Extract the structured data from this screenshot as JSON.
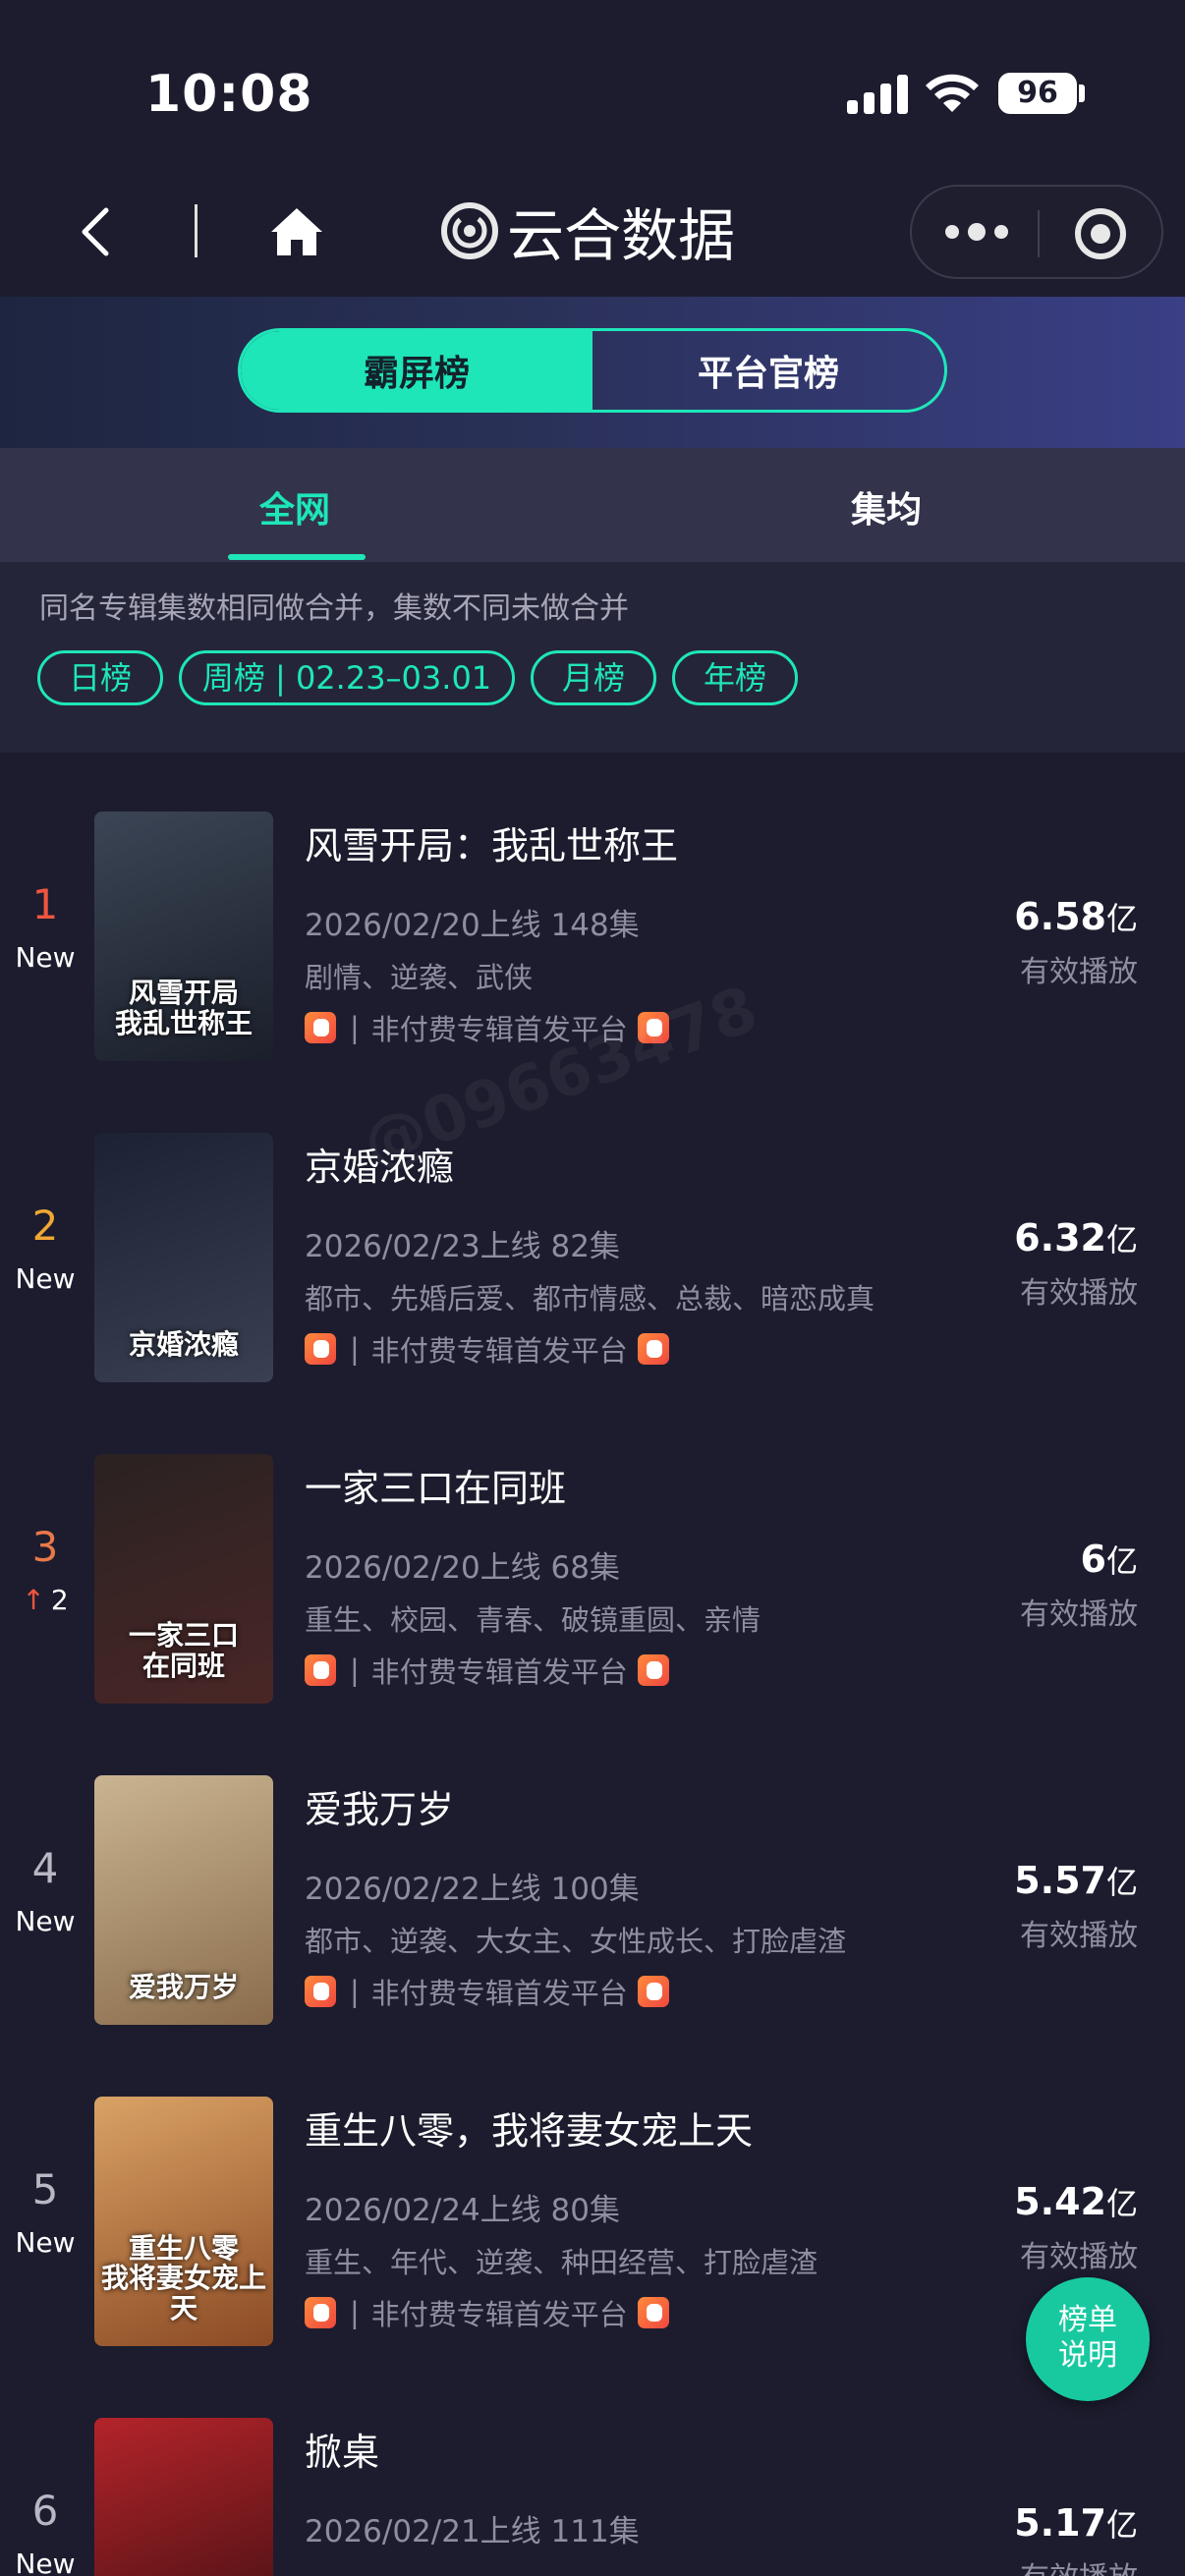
{
  "status_bar": {
    "time": "10:08",
    "battery": "96"
  },
  "nav": {
    "brand_name": "云合数据"
  },
  "segments": [
    {
      "label": "霸屏榜",
      "active": true
    },
    {
      "label": "平台官榜",
      "active": false
    }
  ],
  "tabs": [
    {
      "label": "全网",
      "active": true
    },
    {
      "label": "集均",
      "active": false
    }
  ],
  "filters": {
    "note": "同名专辑集数相同做合并，集数不同未做合并",
    "chips": [
      "日榜",
      "周榜 | 02.23–03.01",
      "月榜",
      "年榜"
    ]
  },
  "list": [
    {
      "rank": "1",
      "badge": "New",
      "title": "风雪开局：我乱世称王",
      "meta": "2026/02/20上线 148集",
      "tags": "剧情、逆袭、武侠",
      "platform": "非付费专辑首发平台",
      "value": "6.58",
      "unit": "亿",
      "value_label": "有效播放",
      "poster_text": "风雪开局\n我乱世称王",
      "poster_colors": [
        "#3b4555",
        "#1a1f2a"
      ]
    },
    {
      "rank": "2",
      "badge": "New",
      "title": "京婚浓瘾",
      "meta": "2026/02/23上线 82集",
      "tags": "都市、先婚后爱、都市情感、总裁、暗恋成真",
      "platform": "非付费专辑首发平台",
      "value": "6.32",
      "unit": "亿",
      "value_label": "有效播放",
      "poster_text": "京婚浓瘾",
      "poster_colors": [
        "#1c2234",
        "#3a4052"
      ]
    },
    {
      "rank": "3",
      "badge": "2",
      "badge_up": true,
      "title": "一家三口在同班",
      "meta": "2026/02/20上线 68集",
      "tags": "重生、校园、青春、破镜重圆、亲情",
      "platform": "非付费专辑首发平台",
      "value": "6",
      "unit": "亿",
      "value_label": "有效播放",
      "poster_text": "一家三口\n在同班",
      "poster_colors": [
        "#2a2222",
        "#4a2626"
      ]
    },
    {
      "rank": "4",
      "badge": "New",
      "title": "爱我万岁",
      "meta": "2026/02/22上线 100集",
      "tags": "都市、逆袭、大女主、女性成长、打脸虐渣",
      "platform": "非付费专辑首发平台",
      "value": "5.57",
      "unit": "亿",
      "value_label": "有效播放",
      "poster_text": "爱我万岁",
      "poster_colors": [
        "#c9b491",
        "#8a6c4c"
      ]
    },
    {
      "rank": "5",
      "badge": "New",
      "title": "重生八零，我将妻女宠上天",
      "meta": "2026/02/24上线 80集",
      "tags": "重生、年代、逆袭、种田经营、打脸虐渣",
      "platform": "非付费专辑首发平台",
      "value": "5.42",
      "unit": "亿",
      "value_label": "有效播放",
      "poster_text": "重生八零\n我将妻女宠上天",
      "poster_colors": [
        "#d9a265",
        "#8c4a24"
      ]
    },
    {
      "rank": "6",
      "badge": "New",
      "title": "掀桌",
      "meta": "2026/02/21上线 111集",
      "tags": "",
      "platform": "",
      "value": "5.17",
      "unit": "亿",
      "value_label": "有效播放",
      "poster_text": "",
      "poster_colors": [
        "#b3242a",
        "#3a0e10"
      ]
    }
  ],
  "float_button": "榜单\n说明",
  "watermark": "@09663478"
}
